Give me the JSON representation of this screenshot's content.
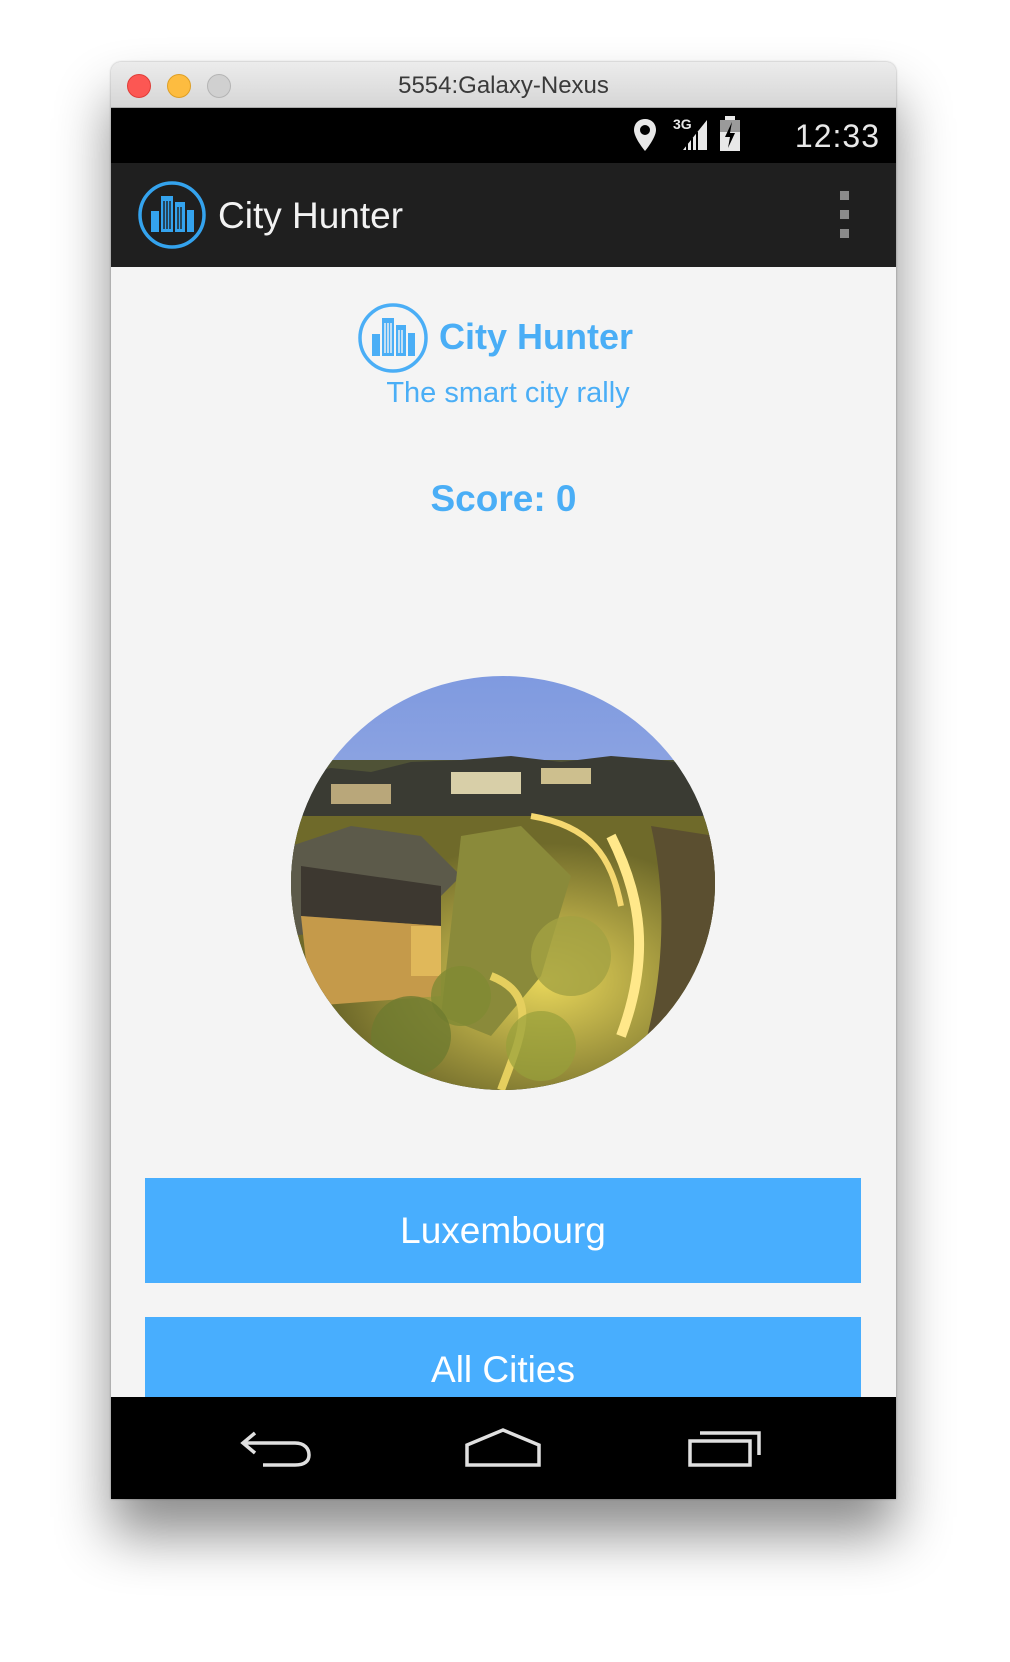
{
  "window": {
    "title": "5554:Galaxy-Nexus"
  },
  "status_bar": {
    "time": "12:33",
    "network": "3G",
    "icons": [
      "location-pin-icon",
      "signal-3g-icon",
      "battery-charging-icon"
    ]
  },
  "action_bar": {
    "title": "City Hunter",
    "logo_icon": "city-buildings-icon",
    "menu_icon": "overflow-menu-icon"
  },
  "header": {
    "title": "City Hunter",
    "subtitle": "The smart city rally",
    "logo_icon": "city-buildings-icon"
  },
  "score": {
    "label": "Score: 0"
  },
  "photo": {
    "subject": "night-city-photo"
  },
  "buttons": {
    "primary": "Luxembourg",
    "secondary": "All Cities"
  },
  "nav_bar": {
    "icons": [
      "back-icon",
      "home-icon",
      "recent-apps-icon"
    ]
  },
  "colors": {
    "accent": "#4aaef6",
    "button_bg": "#48aefe",
    "action_bar_bg": "#1f1f1f",
    "content_bg": "#f4f4f4",
    "system_bar_bg": "#000000"
  }
}
